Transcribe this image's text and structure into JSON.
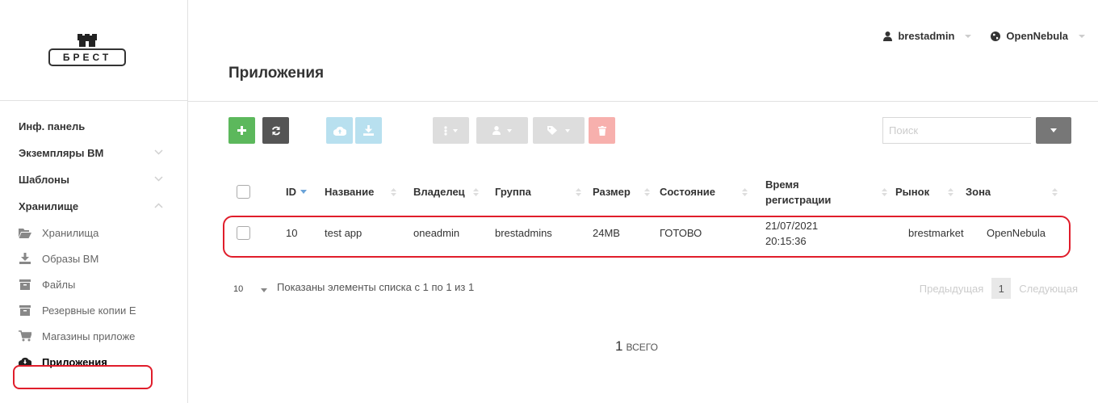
{
  "logo": {
    "text": "БРЕСТ"
  },
  "topbar": {
    "user": "brestadmin",
    "zone": "OpenNebula"
  },
  "page": {
    "title": "Приложения"
  },
  "sidebar": {
    "items": [
      {
        "label": "Инф. панель"
      },
      {
        "label": "Экземпляры ВМ"
      },
      {
        "label": "Шаблоны"
      },
      {
        "label": "Хранилище"
      }
    ],
    "storage_sub": [
      {
        "label": "Хранилища",
        "icon": "folder-open-icon"
      },
      {
        "label": "Образы ВМ",
        "icon": "download-icon"
      },
      {
        "label": "Файлы",
        "icon": "archive-icon"
      },
      {
        "label": "Резервные копии E",
        "icon": "archive-icon"
      },
      {
        "label": "Магазины приложе",
        "icon": "cart-icon"
      },
      {
        "label": "Приложения",
        "icon": "cloud-download-icon"
      }
    ]
  },
  "search": {
    "placeholder": "Поиск"
  },
  "table": {
    "columns": [
      "ID",
      "Название",
      "Владелец",
      "Группа",
      "Размер",
      "Состояние",
      "Время регистрации",
      "Рынок",
      "Зона"
    ],
    "rows": [
      {
        "id": "10",
        "name": "test app",
        "owner": "oneadmin",
        "group": "brestadmins",
        "size": "24MB",
        "state": "ГОТОВО",
        "reg_date": "21/07/2021",
        "reg_time": "20:15:36",
        "market": "brestmarket",
        "zone": "OpenNebula"
      }
    ]
  },
  "footer": {
    "page_length": "10",
    "info": "Показаны элементы списка с 1 по 1 из 1",
    "prev": "Предыдущая",
    "current": "1",
    "next": "Следующая"
  },
  "summary": {
    "count": "1",
    "label": "ВСЕГО"
  },
  "colors": {
    "green": "#5cb85c",
    "dark": "#555555",
    "cloud_light": "#b8e0ef",
    "gray_light": "#dddddd",
    "red_light": "#f7b0ad",
    "highlight": "#e01d2b"
  }
}
